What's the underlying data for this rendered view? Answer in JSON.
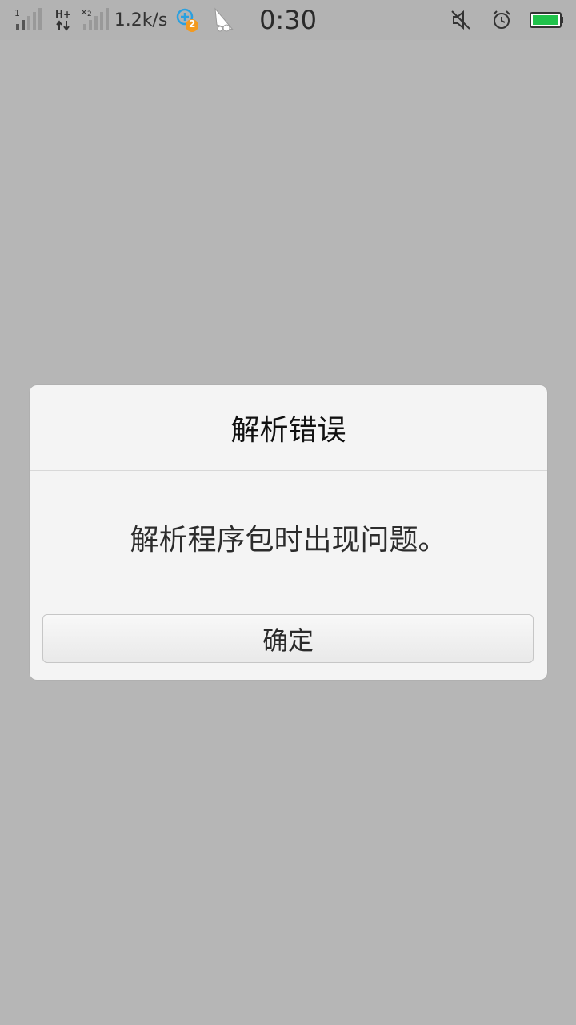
{
  "status_bar": {
    "sim1_label": "1",
    "network_type": "H+",
    "sim2_label": "2",
    "net_speed": "1.2k/s",
    "notification_count": "2",
    "time": "0:30",
    "battery_color": "#1fc24a",
    "icons": [
      "signal-icon",
      "data-arrows-icon",
      "signal-icon",
      "app-notification-icon",
      "bird-app-icon",
      "mute-icon",
      "alarm-icon",
      "battery-icon"
    ]
  },
  "dialog": {
    "title": "解析错误",
    "message": "解析程序包时出现问题。",
    "ok_button": "确定"
  }
}
